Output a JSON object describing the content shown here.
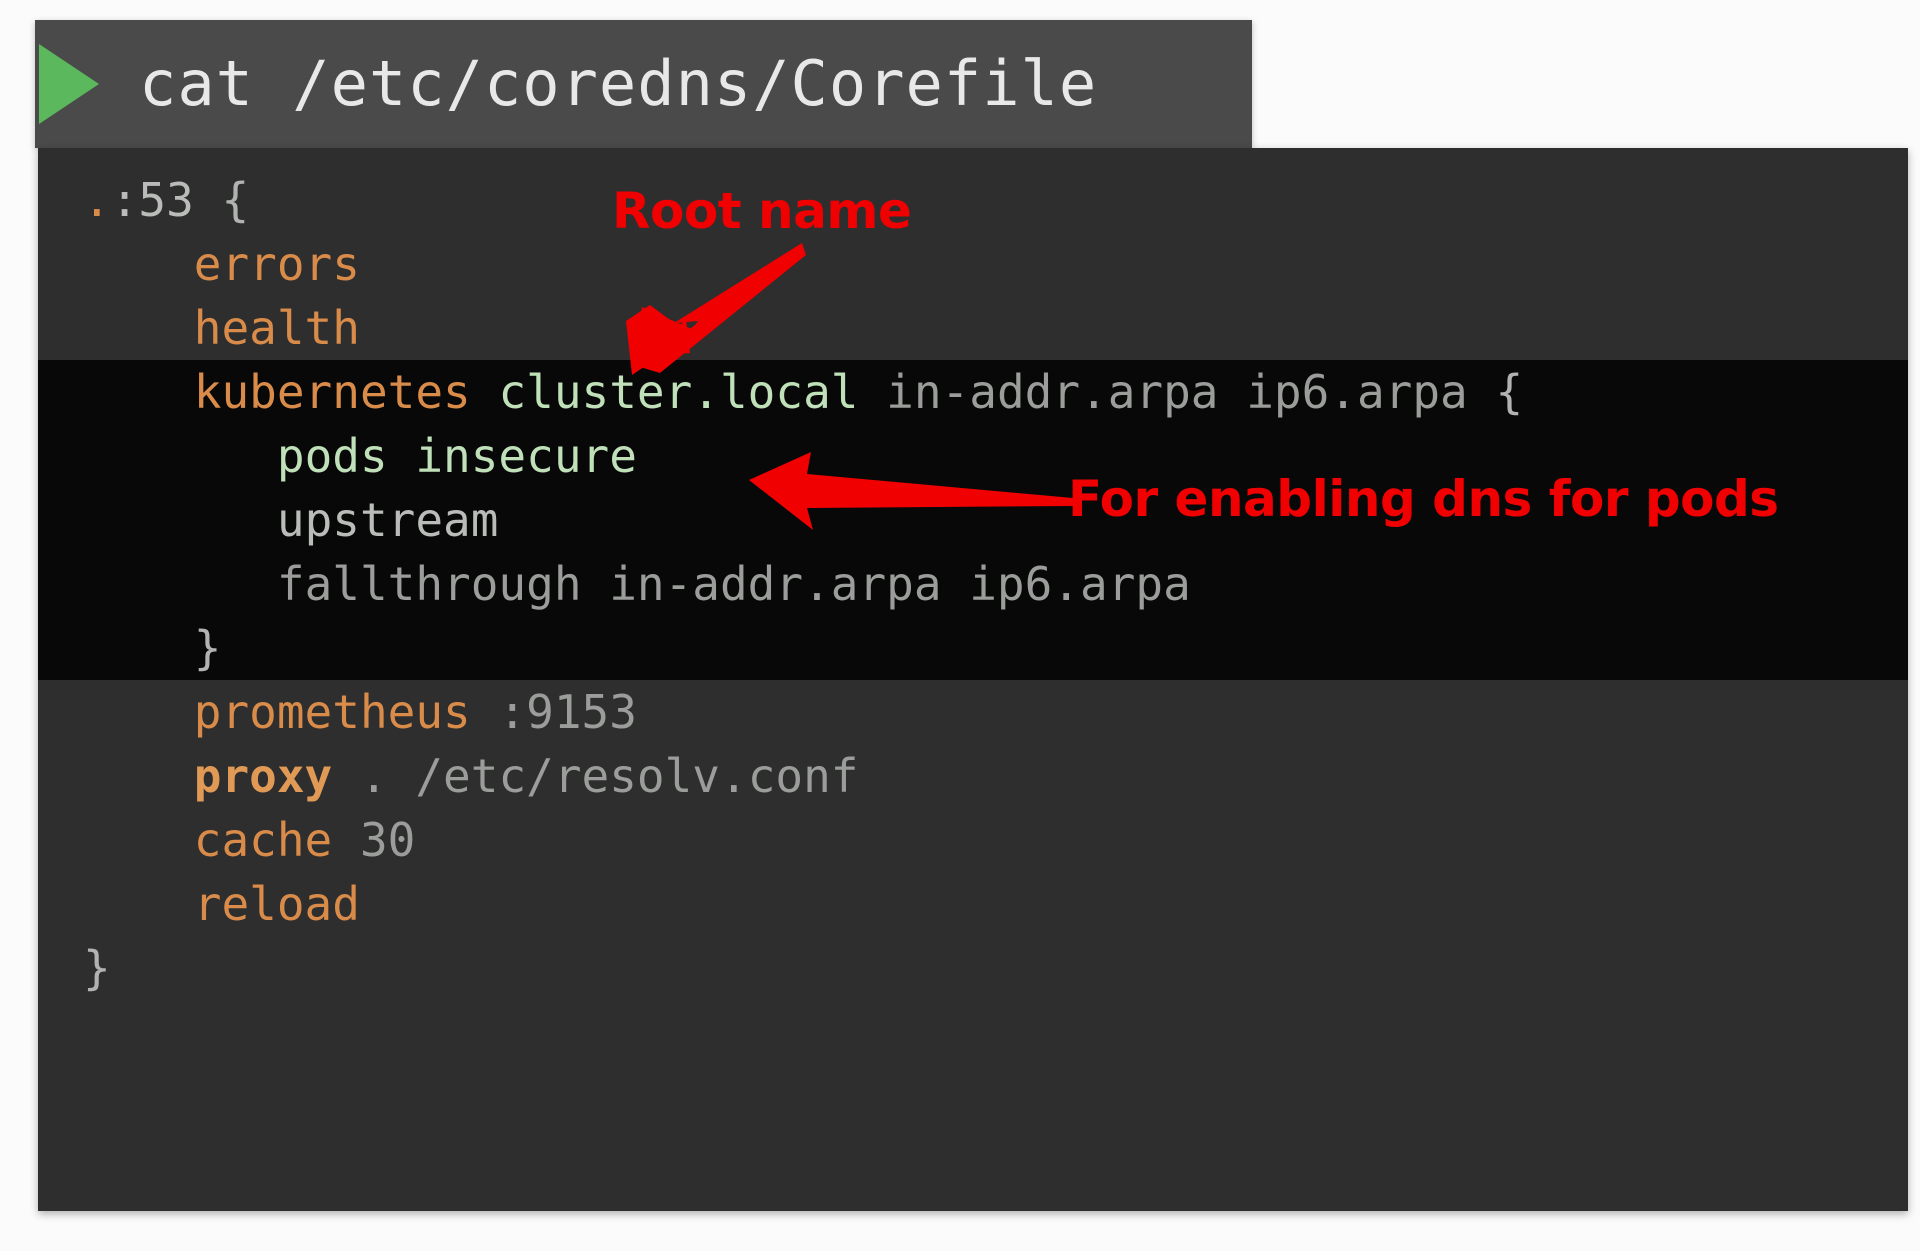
{
  "terminal": {
    "prompt_icon": "play-triangle-icon",
    "command": "cat /etc/coredns/Corefile",
    "file_path": "/etc/coredns/Corefile",
    "colors": {
      "header_bg": "#4a4a4a",
      "body_bg": "#2e2e2e",
      "highlight_bg": "#080808",
      "prompt_green": "#5cb85c",
      "directive_orange": "#d98b4a",
      "value_green": "#bfe0b8",
      "plain_text": "#b9bcb9",
      "annotation_red": "#f00000",
      "page_bg": "#fbfbfb"
    },
    "lines": [
      {
        "id": "line-root-open",
        "highlight": false,
        "tokens": [
          {
            "text": ".",
            "style": "tok-dir"
          },
          {
            "text": ":53 ",
            "style": "tok-plain"
          },
          {
            "text": "{",
            "style": "tok-brace"
          }
        ]
      },
      {
        "id": "line-errors",
        "highlight": false,
        "tokens": [
          {
            "text": "    ",
            "style": "tok-plain"
          },
          {
            "text": "errors",
            "style": "tok-dir"
          }
        ]
      },
      {
        "id": "line-health",
        "highlight": false,
        "tokens": [
          {
            "text": "    ",
            "style": "tok-plain"
          },
          {
            "text": "health",
            "style": "tok-dir"
          }
        ]
      },
      {
        "id": "line-kubernetes",
        "highlight": true,
        "tokens": [
          {
            "text": "    ",
            "style": "tok-plain"
          },
          {
            "text": "kubernetes",
            "style": "tok-dir"
          },
          {
            "text": " ",
            "style": "tok-plain"
          },
          {
            "text": "cluster.local",
            "style": "tok-green"
          },
          {
            "text": " ",
            "style": "tok-plain"
          },
          {
            "text": "in-addr.arpa ip6.arpa ",
            "style": "tok-dim"
          },
          {
            "text": "{",
            "style": "tok-brace"
          }
        ]
      },
      {
        "id": "line-pods",
        "highlight": true,
        "tokens": [
          {
            "text": "       ",
            "style": "tok-plain"
          },
          {
            "text": "pods insecure",
            "style": "tok-green"
          }
        ]
      },
      {
        "id": "line-upstream",
        "highlight": true,
        "tokens": [
          {
            "text": "       ",
            "style": "tok-plain"
          },
          {
            "text": "upstream",
            "style": "tok-plain"
          }
        ]
      },
      {
        "id": "line-fallthrough",
        "highlight": true,
        "tokens": [
          {
            "text": "       ",
            "style": "tok-plain"
          },
          {
            "text": "fallthrough in-addr.arpa ip6.arpa",
            "style": "tok-dim"
          }
        ]
      },
      {
        "id": "line-k8s-close",
        "highlight": true,
        "tokens": [
          {
            "text": "    ",
            "style": "tok-plain"
          },
          {
            "text": "}",
            "style": "tok-brace"
          }
        ]
      },
      {
        "id": "line-prometheus",
        "highlight": false,
        "tokens": [
          {
            "text": "    ",
            "style": "tok-plain"
          },
          {
            "text": "prometheus",
            "style": "tok-dir"
          },
          {
            "text": " ",
            "style": "tok-plain"
          },
          {
            "text": ":9153",
            "style": "tok-dim"
          }
        ]
      },
      {
        "id": "line-proxy",
        "highlight": false,
        "tokens": [
          {
            "text": "    ",
            "style": "tok-plain"
          },
          {
            "text": "proxy",
            "style": "tok-dir-b"
          },
          {
            "text": " ",
            "style": "tok-plain"
          },
          {
            "text": ". /etc/resolv.conf",
            "style": "tok-dim"
          }
        ]
      },
      {
        "id": "line-cache",
        "highlight": false,
        "tokens": [
          {
            "text": "    ",
            "style": "tok-plain"
          },
          {
            "text": "cache",
            "style": "tok-dir"
          },
          {
            "text": " ",
            "style": "tok-plain"
          },
          {
            "text": "30",
            "style": "tok-dim"
          }
        ]
      },
      {
        "id": "line-reload",
        "highlight": false,
        "tokens": [
          {
            "text": "    ",
            "style": "tok-plain"
          },
          {
            "text": "reload",
            "style": "tok-dir"
          }
        ]
      },
      {
        "id": "line-root-close",
        "highlight": false,
        "tokens": [
          {
            "text": "}",
            "style": "tok-brace"
          }
        ]
      }
    ]
  },
  "annotations": [
    {
      "id": "anno-root",
      "text": "Root name",
      "arrow": "arrow-down-left-icon",
      "points_to": "cluster.local"
    },
    {
      "id": "anno-pods",
      "text": "For enabling dns for pods",
      "arrow": "arrow-left-icon",
      "points_to": "pods insecure"
    }
  ]
}
